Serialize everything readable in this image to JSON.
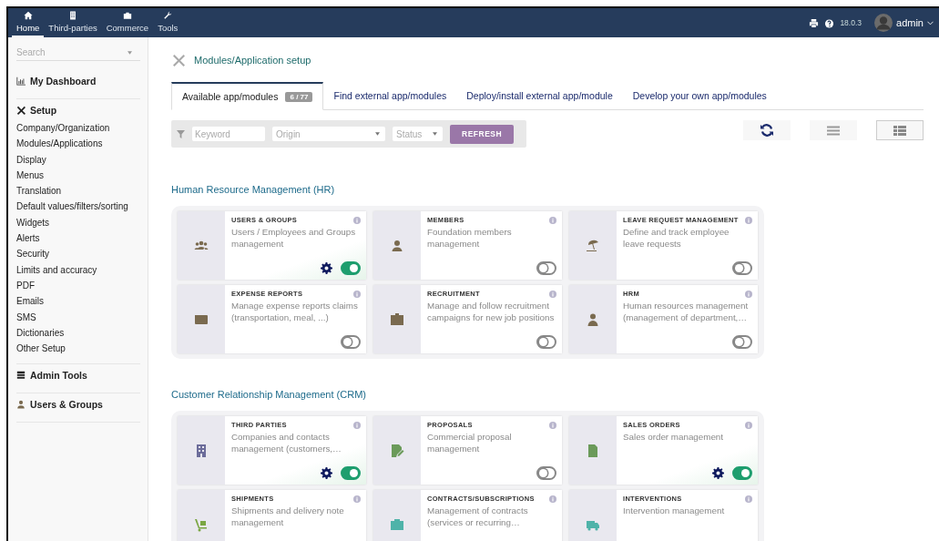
{
  "topbar": {
    "menu": [
      {
        "label": "Home",
        "selected": true
      },
      {
        "label": "Third-parties",
        "selected": false
      },
      {
        "label": "Commerce",
        "selected": false
      },
      {
        "label": "Tools",
        "selected": false
      }
    ],
    "version": "18.0.3",
    "user": "admin"
  },
  "sidebar": {
    "search": {
      "placeholder": "Search"
    },
    "sections": [
      {
        "title": "My Dashboard"
      },
      {
        "title": "Setup",
        "items": [
          "Company/Organization",
          "Modules/Applications",
          "Display",
          "Menus",
          "Translation",
          "Default values/filters/sorting",
          "Widgets",
          "Alerts",
          "Security",
          "Limits and accuracy",
          "PDF",
          "Emails",
          "SMS",
          "Dictionaries",
          "Other Setup"
        ]
      },
      {
        "title": "Admin Tools"
      },
      {
        "title": "Users & Groups"
      }
    ]
  },
  "page": {
    "title": "Modules/Application setup",
    "tabs": [
      {
        "label": "Available app/modules",
        "badge": "6 / 77",
        "selected": true
      },
      {
        "label": "Find external app/modules",
        "selected": false
      },
      {
        "label": "Deploy/install external app/module",
        "selected": false
      },
      {
        "label": "Develop your own app/modules",
        "selected": false
      }
    ],
    "filters": {
      "keyword": {
        "placeholder": "Keyword"
      },
      "origin": {
        "placeholder": "Origin"
      },
      "status": {
        "placeholder": "Status"
      },
      "button": "REFRESH"
    },
    "view_buttons": [
      {
        "selected": false
      },
      {
        "selected": true
      }
    ],
    "sections": [
      {
        "title": "Human Resource Management (HR)",
        "modules": [
          {
            "title": "USERS & GROUPS",
            "description": "Users / Employees and Groups management",
            "kind": "group",
            "color": "#7a6a4f",
            "enabled": true,
            "configurable": true
          },
          {
            "title": "MEMBERS",
            "description": "Foundation members management",
            "kind": "person",
            "color": "#7a6a4f",
            "enabled": false,
            "configurable": false
          },
          {
            "title": "LEAVE REQUEST MANAGEMENT",
            "description": "Define and track employee leave requests",
            "kind": "umbrella",
            "color": "#7a6a4f",
            "enabled": false,
            "configurable": false
          },
          {
            "title": "EXPENSE REPORTS",
            "description": "Manage expense reports claims (transportation, meal, ...)",
            "kind": "wallet",
            "color": "#7a6a4f",
            "enabled": false,
            "configurable": false
          },
          {
            "title": "RECRUITMENT",
            "description": "Manage and follow recruitment campaigns for new job positions",
            "kind": "badge",
            "color": "#7a6a4f",
            "enabled": false,
            "configurable": false
          },
          {
            "title": "HRM",
            "description": "Human resources management (management of department,…",
            "kind": "suit",
            "color": "#7a6a4f",
            "enabled": false,
            "configurable": false
          }
        ]
      },
      {
        "title": "Customer Relationship Management (CRM)",
        "modules": [
          {
            "title": "THIRD PARTIES",
            "description": "Companies and contacts management (customers,…",
            "kind": "building",
            "color": "#6c6c9a",
            "enabled": true,
            "configurable": true
          },
          {
            "title": "PROPOSALS",
            "description": "Commercial proposal management",
            "kind": "docpen",
            "color": "#6b9a5a",
            "enabled": false,
            "configurable": false
          },
          {
            "title": "SALES ORDERS",
            "description": "Sales order management",
            "kind": "doc",
            "color": "#6b9a5a",
            "enabled": true,
            "configurable": true
          },
          {
            "title": "SHIPMENTS",
            "description": "Shipments and delivery note management",
            "kind": "cart",
            "color": "#7aa642"
          },
          {
            "title": "CONTRACTS/SUBSCRIPTIONS",
            "description": "Management of contracts (services or recurring…",
            "kind": "briefcase",
            "color": "#4fb3a9"
          },
          {
            "title": "INTERVENTIONS",
            "description": "Intervention management",
            "kind": "truck",
            "color": "#4fb3a9"
          }
        ]
      }
    ]
  }
}
